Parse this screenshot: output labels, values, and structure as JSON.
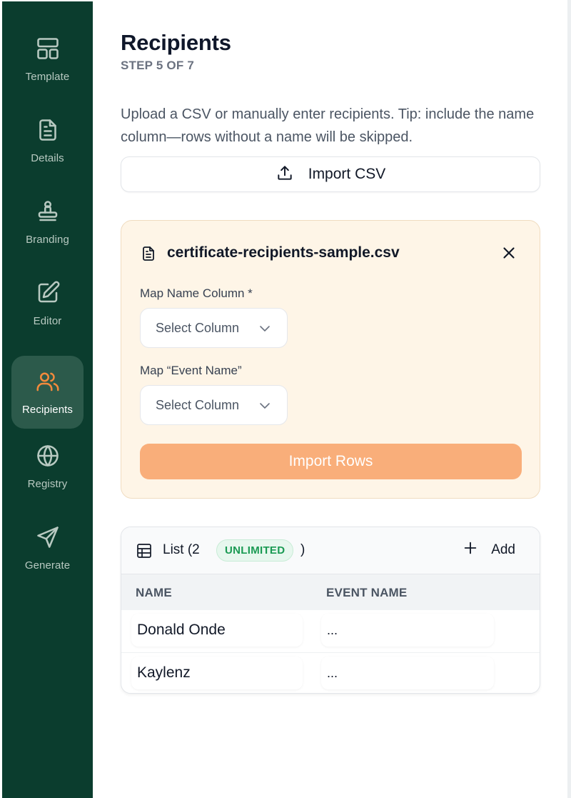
{
  "sidebar": {
    "items": [
      {
        "label": "Template",
        "icon": "layout-icon"
      },
      {
        "label": "Details",
        "icon": "file-text-icon"
      },
      {
        "label": "Branding",
        "icon": "stamp-icon"
      },
      {
        "label": "Editor",
        "icon": "edit-icon"
      },
      {
        "label": "Recipients",
        "icon": "users-icon",
        "active": true
      },
      {
        "label": "Registry",
        "icon": "globe-icon"
      },
      {
        "label": "Generate",
        "icon": "send-icon"
      }
    ],
    "background": "#0b3d2e",
    "active_color": "#f28a3c"
  },
  "header": {
    "title": "Recipients",
    "step": "STEP 5 OF 7"
  },
  "description": "Upload a CSV or manually enter recipients. Tip: include the name column—rows without a name will be skipped.",
  "import_csv": {
    "label": "Import CSV",
    "icon": "upload-icon"
  },
  "csv_panel": {
    "file_name": "certificate-recipients-sample.csv",
    "name_map_label": "Map Name Column *",
    "name_select_value": "Select Column",
    "event_map_label": "Map “Event Name”",
    "event_select_value": "Select Column",
    "import_rows_label": "Import Rows",
    "accent": "#f9ae7a"
  },
  "list": {
    "title": "List (2",
    "badge": "UNLIMITED",
    "close_paren": ")",
    "add_label": "Add",
    "columns": [
      "NAME",
      "EVENT NAME"
    ],
    "rows": [
      {
        "name": "Donald Onde",
        "event": "..."
      },
      {
        "name": "Kaylenz",
        "event": "..."
      }
    ]
  }
}
